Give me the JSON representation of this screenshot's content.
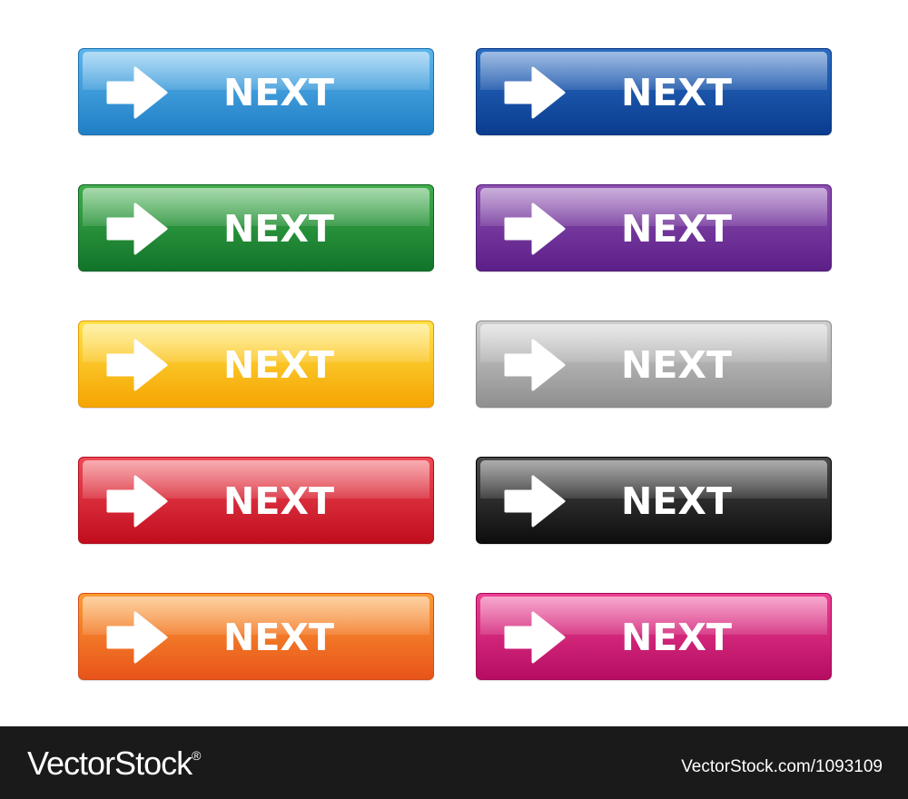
{
  "buttons": [
    {
      "label": "NEXT",
      "color": "blue",
      "top": "#5db6ec",
      "bottom": "#1f7fc6",
      "border": "#1a6fae"
    },
    {
      "label": "NEXT",
      "color": "navy",
      "top": "#2b6cc2",
      "bottom": "#0a3c8f",
      "border": "#0a3580"
    },
    {
      "label": "NEXT",
      "color": "green",
      "top": "#3fad4a",
      "bottom": "#11742a",
      "border": "#0e6424"
    },
    {
      "label": "NEXT",
      "color": "purple",
      "top": "#8c4fb0",
      "bottom": "#5c1f88",
      "border": "#521b7a"
    },
    {
      "label": "NEXT",
      "color": "yellow",
      "top": "#ffe34a",
      "bottom": "#f5a400",
      "border": "#e59a00"
    },
    {
      "label": "NEXT",
      "color": "gray",
      "top": "#cfcfcf",
      "bottom": "#8f8f8f",
      "border": "#888888"
    },
    {
      "label": "NEXT",
      "color": "red",
      "top": "#ef4a55",
      "bottom": "#c10d1e",
      "border": "#ae0b1b"
    },
    {
      "label": "NEXT",
      "color": "black",
      "top": "#4a4a4a",
      "bottom": "#0d0d0d",
      "border": "#000000"
    },
    {
      "label": "NEXT",
      "color": "orange",
      "top": "#fb9b33",
      "bottom": "#e8541a",
      "border": "#d44c16"
    },
    {
      "label": "NEXT",
      "color": "pink",
      "top": "#ec3f92",
      "bottom": "#b60d62",
      "border": "#a40b58"
    }
  ],
  "footer": {
    "logo": "VectorStock",
    "registered": "®",
    "image_id": "VectorStock.com/1093109"
  }
}
